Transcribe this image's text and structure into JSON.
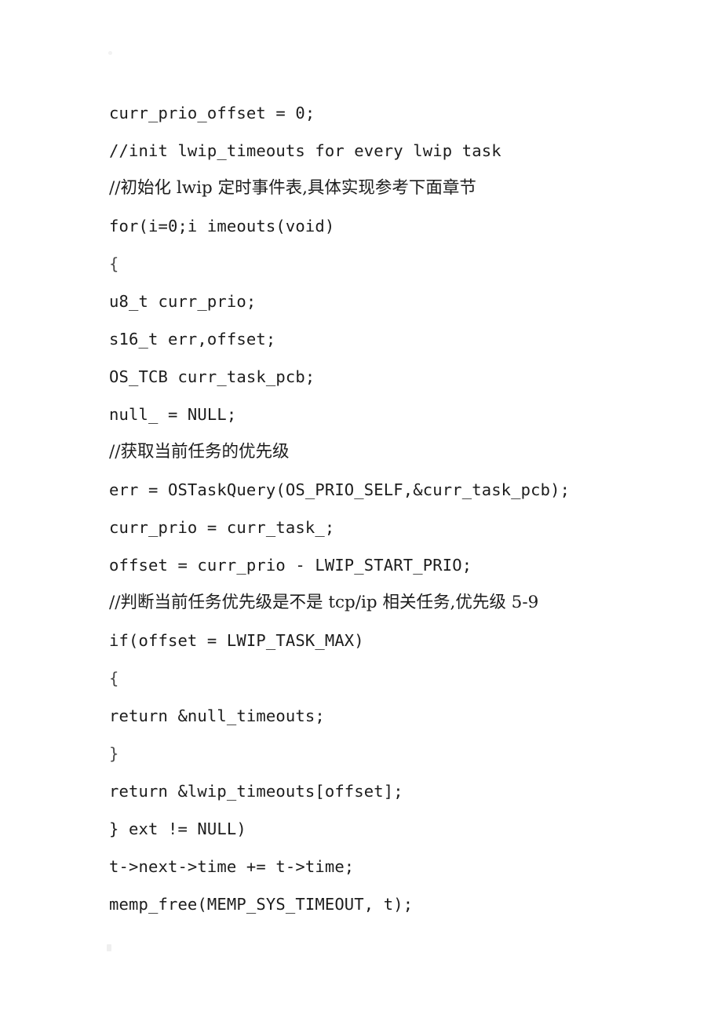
{
  "document": {
    "type": "scanned-code-page",
    "background_color": "#ffffff",
    "text_color": "#1c1c1c",
    "language": "C",
    "code_lines": [
      {
        "text": "curr_prio_offset = 0;",
        "cjk": false,
        "brace": false
      },
      {
        "text": "//init lwip_timeouts for every lwip task",
        "cjk": false,
        "brace": false
      },
      {
        "text": "//初始化 lwip 定时事件表,具体实现参考下面章节",
        "cjk": true,
        "brace": false
      },
      {
        "text": "for(i=0;i imeouts(void)",
        "cjk": false,
        "brace": false
      },
      {
        "text": "{",
        "cjk": false,
        "brace": true
      },
      {
        "text": "u8_t curr_prio;",
        "cjk": false,
        "brace": false
      },
      {
        "text": "s16_t err,offset;",
        "cjk": false,
        "brace": false
      },
      {
        "text": "OS_TCB curr_task_pcb;",
        "cjk": false,
        "brace": false
      },
      {
        "text": "null_ = NULL;",
        "cjk": false,
        "brace": false
      },
      {
        "text": "//获取当前任务的优先级",
        "cjk": true,
        "brace": false
      },
      {
        "text": "err = OSTaskQuery(OS_PRIO_SELF,&curr_task_pcb);",
        "cjk": false,
        "brace": false
      },
      {
        "text": "curr_prio = curr_task_;",
        "cjk": false,
        "brace": false
      },
      {
        "text": "offset = curr_prio - LWIP_START_PRIO;",
        "cjk": false,
        "brace": false
      },
      {
        "text": "//判断当前任务优先级是不是 tcp/ip 相关任务,优先级 5-9",
        "cjk": true,
        "brace": false
      },
      {
        "text": "if(offset = LWIP_TASK_MAX)",
        "cjk": false,
        "brace": false
      },
      {
        "text": "{",
        "cjk": false,
        "brace": true
      },
      {
        "text": "return &null_timeouts;",
        "cjk": false,
        "brace": false
      },
      {
        "text": "}",
        "cjk": false,
        "brace": true
      },
      {
        "text": "return &lwip_timeouts[offset];",
        "cjk": false,
        "brace": false
      },
      {
        "text": "} ext != NULL)",
        "cjk": false,
        "brace": false
      },
      {
        "text": "t->next->time += t->time;",
        "cjk": false,
        "brace": false
      },
      {
        "text": "memp_free(MEMP_SYS_TIMEOUT, t);",
        "cjk": false,
        "brace": false
      }
    ]
  }
}
